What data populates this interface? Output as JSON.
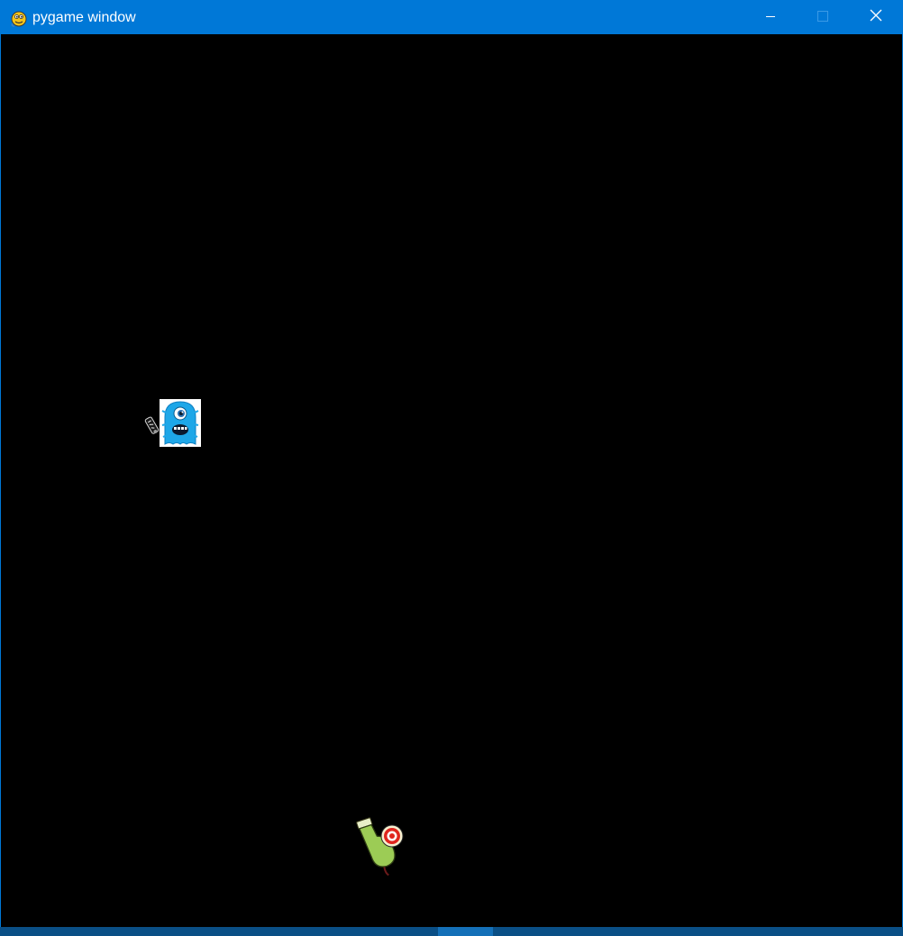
{
  "window": {
    "title": "pygame window",
    "titlebar_color": "#0078d7",
    "background_color": "#000000",
    "app_icon": "pygame-snake-icon",
    "controls": {
      "minimize_icon": "minimize-icon",
      "maximize_icon": "maximize-icon",
      "close_icon": "close-icon"
    }
  },
  "game": {
    "sprites": [
      {
        "name": "blue-monster",
        "icon": "blue-one-eyed-monster-icon"
      },
      {
        "name": "enemy-bullet",
        "icon": "small-bullet-icon"
      },
      {
        "name": "player",
        "icon": "green-cannon-with-red-target-icon"
      }
    ]
  }
}
